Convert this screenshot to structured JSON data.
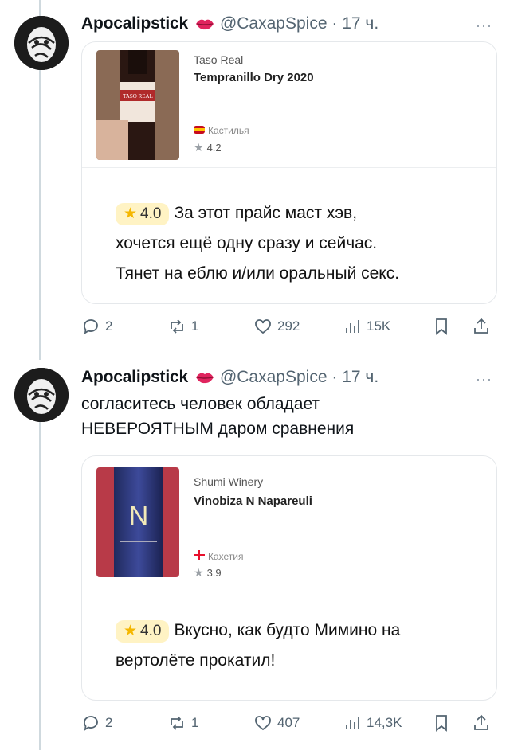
{
  "posts": [
    {
      "author": "Apocalipstick",
      "handle": "@CaxapSpice",
      "time": "17 ч.",
      "more": "···",
      "text_lines": [],
      "card": {
        "winery": "Taso Real",
        "wine": "Tempranillo Dry 2020",
        "region": "Кастилья",
        "region_flag": "spain-flag-icon",
        "rating": "4.2",
        "badge": "4.0",
        "review_lines": [
          "За этот прайс маст хэв,",
          "хочется ещё одну сразу и сейчас.",
          "Тянет на еблю и/или оральный секс."
        ]
      },
      "stats": {
        "replies": "2",
        "reposts": "1",
        "likes": "292",
        "views": "15K"
      }
    },
    {
      "author": "Apocalipstick",
      "handle": "@CaxapSpice",
      "time": "17 ч.",
      "more": "···",
      "text_lines": [
        "согласитесь человек обладает",
        "НЕВЕРОЯТНЫМ даром сравнения"
      ],
      "card": {
        "winery": "Shumi Winery",
        "wine": "Vinobiza N Napareuli",
        "region": "Кахетия",
        "region_flag": "georgia-flag-icon",
        "rating": "3.9",
        "badge": "4.0",
        "review_lines": [
          "Вкусно, как будто Мимино на",
          "вертолёте прокатил!"
        ]
      },
      "stats": {
        "replies": "2",
        "reposts": "1",
        "likes": "407",
        "views": "14,3K"
      }
    }
  ],
  "colors": {
    "secondary_text": "#536471",
    "star": "#f5b700",
    "badge_bg": "#fff3c4",
    "lips": "#e0245e"
  }
}
